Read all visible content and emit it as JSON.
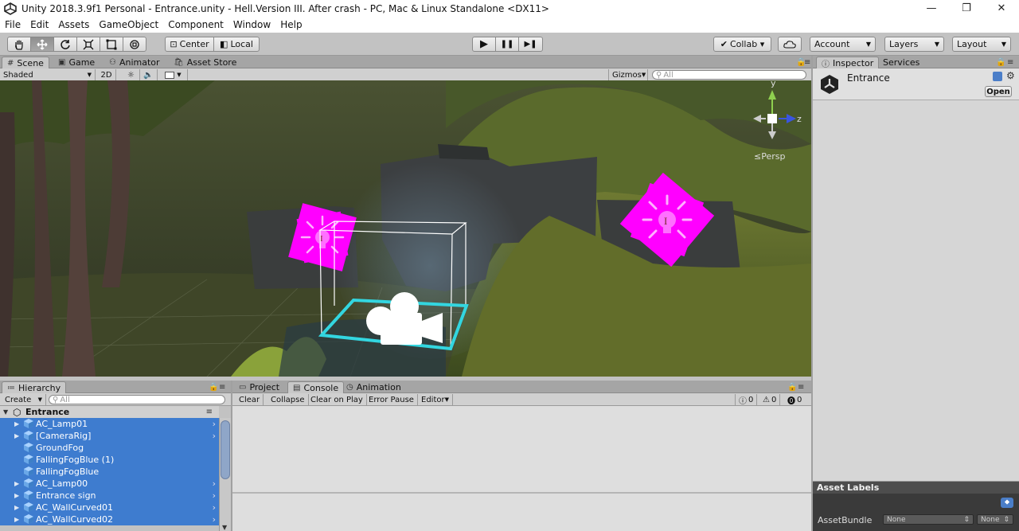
{
  "window": {
    "title": "Unity 2018.3.9f1 Personal - Entrance.unity - Hell.Version III. After crash - PC, Mac & Linux Standalone <DX11>",
    "controls": [
      "—",
      "❐",
      "✕"
    ]
  },
  "menu": [
    "File",
    "Edit",
    "Assets",
    "GameObject",
    "Component",
    "Window",
    "Help"
  ],
  "toolbar": {
    "tools": [
      "hand-tool",
      "move-tool",
      "rotate-tool",
      "scale-tool",
      "rect-tool",
      "transform-tool"
    ],
    "pivot": "Center",
    "space": "Local",
    "play": "▶",
    "pause": "❚❚",
    "step": "▶❚",
    "collab": "Collab ▾",
    "account": "Account",
    "layers": "Layers",
    "layout": "Layout"
  },
  "scene_tabs": {
    "tabs": [
      "Scene",
      "Game",
      "Animator",
      "Asset Store"
    ],
    "shading": "Shaded",
    "mode2d": "2D",
    "gizmos": "Gizmos",
    "search_placeholder": "All",
    "persp": "Persp",
    "gizmo_axes": {
      "y": "y",
      "z": "z"
    }
  },
  "hierarchy": {
    "tab": "Hierarchy",
    "create": "Create",
    "search_placeholder": "All",
    "scene_name": "Entrance",
    "items": [
      {
        "label": "AC_Lamp01",
        "expandable": true
      },
      {
        "label": "[CameraRig]",
        "expandable": true
      },
      {
        "label": "GroundFog",
        "expandable": false
      },
      {
        "label": "FallingFogBlue (1)",
        "expandable": false
      },
      {
        "label": "FallingFogBlue",
        "expandable": false
      },
      {
        "label": "AC_Lamp00",
        "expandable": true
      },
      {
        "label": "Entrance sign",
        "expandable": true
      },
      {
        "label": "AC_WallCurved01",
        "expandable": true
      },
      {
        "label": "AC_WallCurved02",
        "expandable": true
      }
    ]
  },
  "bottom_tabs": [
    "Project",
    "Console",
    "Animation"
  ],
  "console": {
    "buttons": [
      "Clear",
      "Collapse",
      "Clear on Play",
      "Error Pause",
      "Editor"
    ],
    "counts": {
      "info": "0",
      "warn": "0",
      "error": "0"
    }
  },
  "inspector": {
    "tabs": [
      "Inspector",
      "Services"
    ],
    "object_name": "Entrance",
    "open_button": "Open",
    "asset_labels": "Asset Labels",
    "asset_bundle_label": "AssetBundle",
    "asset_bundle_value": "None",
    "asset_bundle_variant": "None"
  },
  "colors": {
    "selection": "#3e7ccf",
    "light_gizmo": "#ff00ff",
    "camera_box": "#33d6e0"
  }
}
